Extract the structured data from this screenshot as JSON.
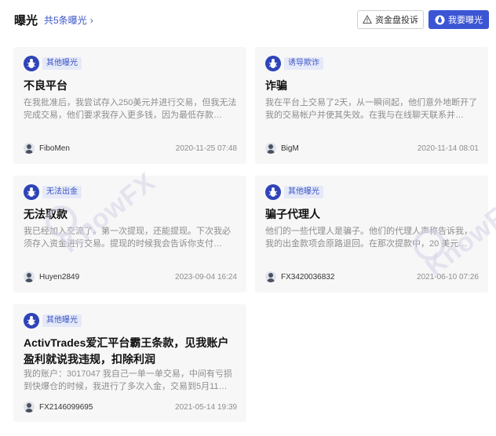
{
  "header": {
    "title": "曝光",
    "count_link": "共5条曝光",
    "complaint_button": "资金盘投诉",
    "expose_button": "我要曝光"
  },
  "cards": [
    {
      "tag": "其他曝光",
      "title": "不良平台",
      "desc": "在我批准后，我尝试存入250美元并进行交易，但我无法完成交易，他们要求我存入更多钱，因为最低存款…",
      "user": "FiboMen",
      "time": "2020-11-25 07:48"
    },
    {
      "tag": "诱导欺诈",
      "title": "诈骗",
      "desc": "我在平台上交易了2天，从一瞬间起，他们意外地断开了我的交易帐户并使其失效。在我与在线聊天联系并…",
      "user": "BigM",
      "time": "2020-11-14 08:01"
    },
    {
      "tag": "无法出金",
      "title": "无法取款",
      "desc": "我已经加入交流了。第一次提现，还能提现。下次我必须存入资金进行交易。提现的时候我会告诉你支付…",
      "user": "Huyen2849",
      "time": "2023-09-04 16:24"
    },
    {
      "tag": "其他曝光",
      "title": "骗子代理人",
      "desc": "他们的一些代理人是骗子。他们的代理人声称告诉我，我的出金款项会原路退回。在那次提款中，20 美元…",
      "user": "FX3420036832",
      "time": "2021-06-10 07:26"
    },
    {
      "tag": "其他曝光",
      "title": "ActivTrades爱汇平台霸王条款，见我账户盈利就说我违规，扣除利润",
      "desc": "我的账户：3017047 我自己一单一单交易，中间有亏损到快爆仓的时候，我进行了多次入金，交易到5月11…",
      "user": "FX2146099695",
      "time": "2021-05-14 19:39"
    }
  ],
  "watermark": "KnowFX",
  "colors": {
    "accent": "#3b55d4",
    "tag_bg": "#e5e9f8",
    "card_bg": "#f7f7f8"
  }
}
